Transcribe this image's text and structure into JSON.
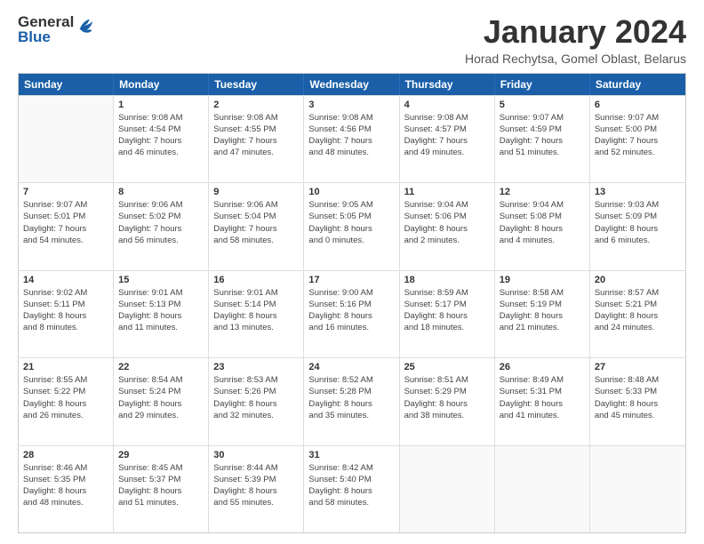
{
  "logo": {
    "general": "General",
    "blue": "Blue"
  },
  "header": {
    "title": "January 2024",
    "subtitle": "Horad Rechytsa, Gomel Oblast, Belarus"
  },
  "days_of_week": [
    "Sunday",
    "Monday",
    "Tuesday",
    "Wednesday",
    "Thursday",
    "Friday",
    "Saturday"
  ],
  "weeks": [
    [
      {
        "day": "",
        "info": ""
      },
      {
        "day": "1",
        "info": "Sunrise: 9:08 AM\nSunset: 4:54 PM\nDaylight: 7 hours\nand 46 minutes."
      },
      {
        "day": "2",
        "info": "Sunrise: 9:08 AM\nSunset: 4:55 PM\nDaylight: 7 hours\nand 47 minutes."
      },
      {
        "day": "3",
        "info": "Sunrise: 9:08 AM\nSunset: 4:56 PM\nDaylight: 7 hours\nand 48 minutes."
      },
      {
        "day": "4",
        "info": "Sunrise: 9:08 AM\nSunset: 4:57 PM\nDaylight: 7 hours\nand 49 minutes."
      },
      {
        "day": "5",
        "info": "Sunrise: 9:07 AM\nSunset: 4:59 PM\nDaylight: 7 hours\nand 51 minutes."
      },
      {
        "day": "6",
        "info": "Sunrise: 9:07 AM\nSunset: 5:00 PM\nDaylight: 7 hours\nand 52 minutes."
      }
    ],
    [
      {
        "day": "7",
        "info": "Sunrise: 9:07 AM\nSunset: 5:01 PM\nDaylight: 7 hours\nand 54 minutes."
      },
      {
        "day": "8",
        "info": "Sunrise: 9:06 AM\nSunset: 5:02 PM\nDaylight: 7 hours\nand 56 minutes."
      },
      {
        "day": "9",
        "info": "Sunrise: 9:06 AM\nSunset: 5:04 PM\nDaylight: 7 hours\nand 58 minutes."
      },
      {
        "day": "10",
        "info": "Sunrise: 9:05 AM\nSunset: 5:05 PM\nDaylight: 8 hours\nand 0 minutes."
      },
      {
        "day": "11",
        "info": "Sunrise: 9:04 AM\nSunset: 5:06 PM\nDaylight: 8 hours\nand 2 minutes."
      },
      {
        "day": "12",
        "info": "Sunrise: 9:04 AM\nSunset: 5:08 PM\nDaylight: 8 hours\nand 4 minutes."
      },
      {
        "day": "13",
        "info": "Sunrise: 9:03 AM\nSunset: 5:09 PM\nDaylight: 8 hours\nand 6 minutes."
      }
    ],
    [
      {
        "day": "14",
        "info": "Sunrise: 9:02 AM\nSunset: 5:11 PM\nDaylight: 8 hours\nand 8 minutes."
      },
      {
        "day": "15",
        "info": "Sunrise: 9:01 AM\nSunset: 5:13 PM\nDaylight: 8 hours\nand 11 minutes."
      },
      {
        "day": "16",
        "info": "Sunrise: 9:01 AM\nSunset: 5:14 PM\nDaylight: 8 hours\nand 13 minutes."
      },
      {
        "day": "17",
        "info": "Sunrise: 9:00 AM\nSunset: 5:16 PM\nDaylight: 8 hours\nand 16 minutes."
      },
      {
        "day": "18",
        "info": "Sunrise: 8:59 AM\nSunset: 5:17 PM\nDaylight: 8 hours\nand 18 minutes."
      },
      {
        "day": "19",
        "info": "Sunrise: 8:58 AM\nSunset: 5:19 PM\nDaylight: 8 hours\nand 21 minutes."
      },
      {
        "day": "20",
        "info": "Sunrise: 8:57 AM\nSunset: 5:21 PM\nDaylight: 8 hours\nand 24 minutes."
      }
    ],
    [
      {
        "day": "21",
        "info": "Sunrise: 8:55 AM\nSunset: 5:22 PM\nDaylight: 8 hours\nand 26 minutes."
      },
      {
        "day": "22",
        "info": "Sunrise: 8:54 AM\nSunset: 5:24 PM\nDaylight: 8 hours\nand 29 minutes."
      },
      {
        "day": "23",
        "info": "Sunrise: 8:53 AM\nSunset: 5:26 PM\nDaylight: 8 hours\nand 32 minutes."
      },
      {
        "day": "24",
        "info": "Sunrise: 8:52 AM\nSunset: 5:28 PM\nDaylight: 8 hours\nand 35 minutes."
      },
      {
        "day": "25",
        "info": "Sunrise: 8:51 AM\nSunset: 5:29 PM\nDaylight: 8 hours\nand 38 minutes."
      },
      {
        "day": "26",
        "info": "Sunrise: 8:49 AM\nSunset: 5:31 PM\nDaylight: 8 hours\nand 41 minutes."
      },
      {
        "day": "27",
        "info": "Sunrise: 8:48 AM\nSunset: 5:33 PM\nDaylight: 8 hours\nand 45 minutes."
      }
    ],
    [
      {
        "day": "28",
        "info": "Sunrise: 8:46 AM\nSunset: 5:35 PM\nDaylight: 8 hours\nand 48 minutes."
      },
      {
        "day": "29",
        "info": "Sunrise: 8:45 AM\nSunset: 5:37 PM\nDaylight: 8 hours\nand 51 minutes."
      },
      {
        "day": "30",
        "info": "Sunrise: 8:44 AM\nSunset: 5:39 PM\nDaylight: 8 hours\nand 55 minutes."
      },
      {
        "day": "31",
        "info": "Sunrise: 8:42 AM\nSunset: 5:40 PM\nDaylight: 8 hours\nand 58 minutes."
      },
      {
        "day": "",
        "info": ""
      },
      {
        "day": "",
        "info": ""
      },
      {
        "day": "",
        "info": ""
      }
    ]
  ]
}
